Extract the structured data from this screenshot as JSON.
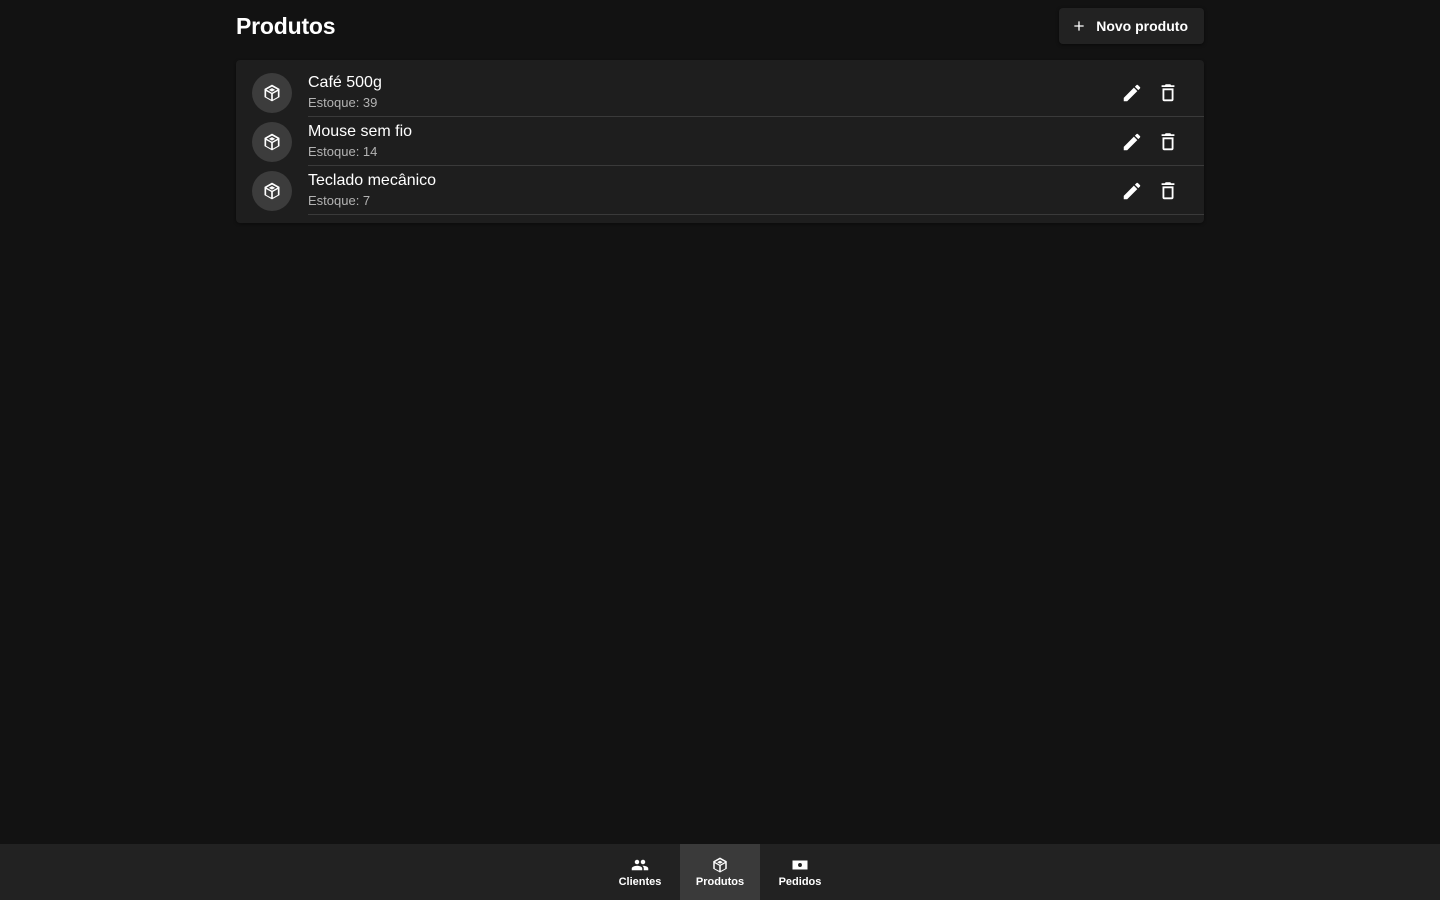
{
  "header": {
    "title": "Produtos",
    "new_button_label": "Novo produto",
    "new_button_icon": "plus-icon"
  },
  "products": [
    {
      "name": "Café 500g",
      "stock": "Estoque: 39",
      "icon": "cube-icon"
    },
    {
      "name": "Mouse sem fio",
      "stock": "Estoque: 14",
      "icon": "cube-icon"
    },
    {
      "name": "Teclado mecânico",
      "stock": "Estoque: 7",
      "icon": "cube-icon"
    }
  ],
  "row_actions": {
    "edit_icon": "pencil-icon",
    "delete_icon": "trash-icon"
  },
  "bottom_nav": {
    "items": [
      {
        "label": "Clientes",
        "icon": "people-icon",
        "active": false
      },
      {
        "label": "Produtos",
        "icon": "cube-icon",
        "active": true
      },
      {
        "label": "Pedidos",
        "icon": "cash-icon",
        "active": false
      }
    ]
  },
  "colors": {
    "background": "#121212",
    "surface": "#1e1e1e",
    "nav_background": "#222222",
    "nav_active": "#3a3a3a",
    "text_primary": "#ffffff",
    "text_secondary": "#b3b3b3"
  }
}
